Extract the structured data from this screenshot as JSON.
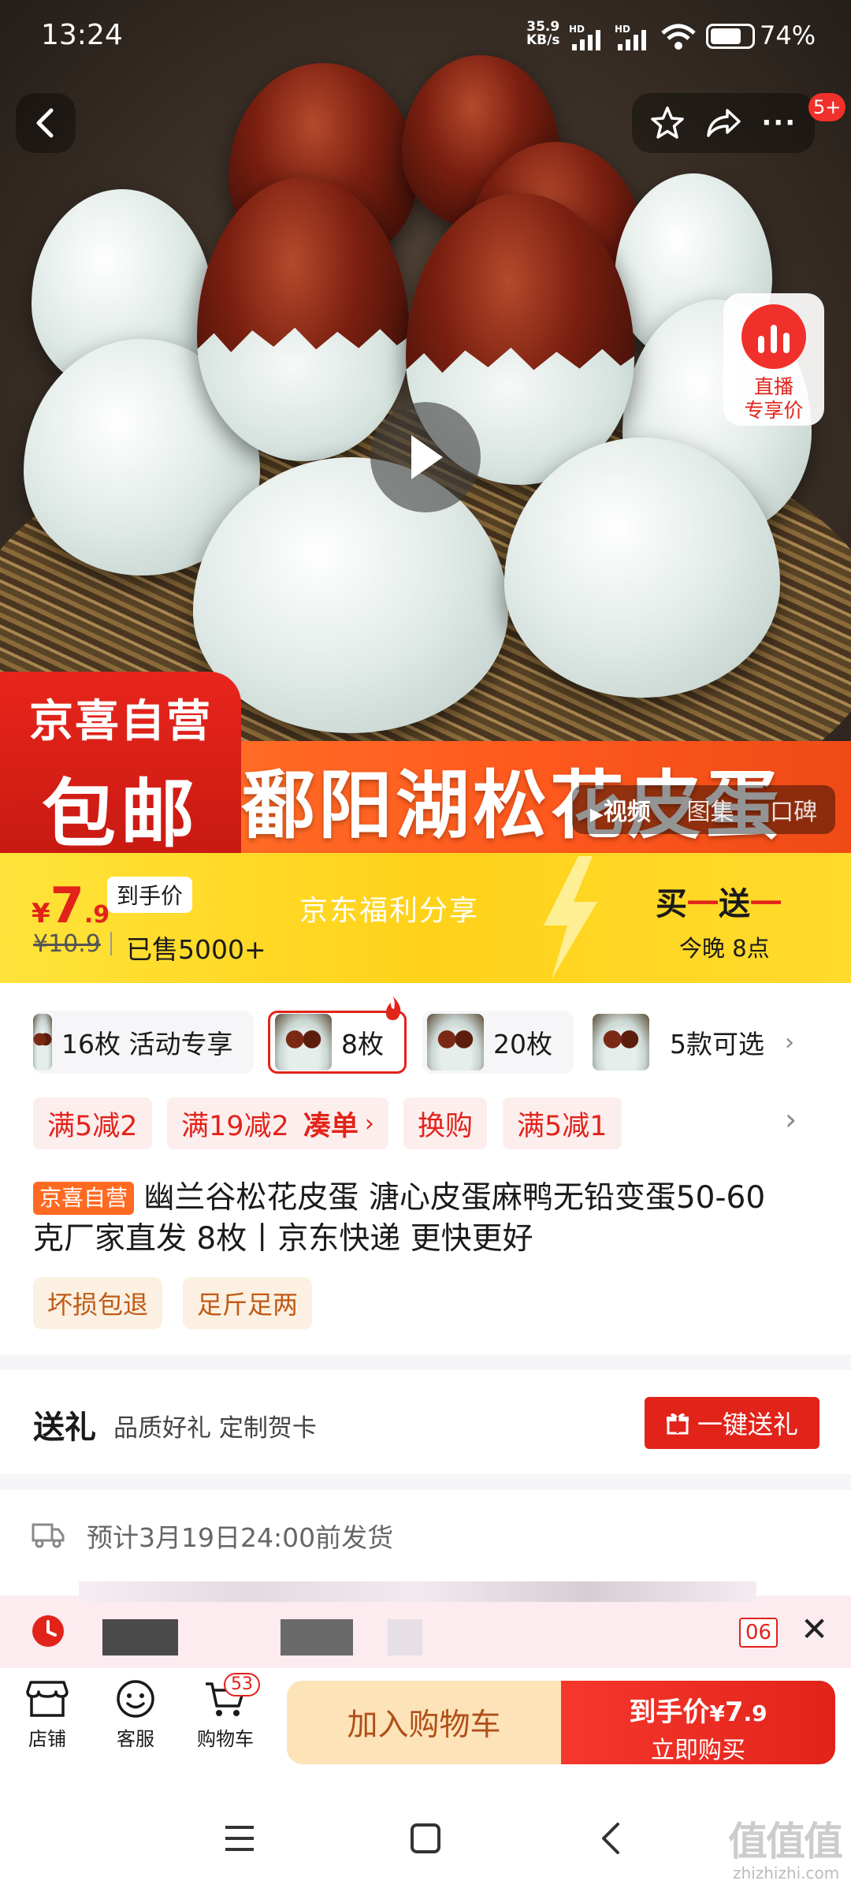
{
  "status_bar": {
    "time": "13:24",
    "net_speed_top": "35.9",
    "net_speed_bottom": "KB/s",
    "hd1": "HD",
    "hd2": "HD",
    "battery": "74%"
  },
  "top_bar": {
    "notification_badge": "5+"
  },
  "hero": {
    "live_label_1": "直播",
    "live_label_2": "专享价",
    "badge_line1": "京喜自营",
    "badge_line2": "包邮",
    "banner_text": "鄱阳湖松花皮蛋",
    "media_tabs": [
      "视频",
      "图集",
      "口碑"
    ]
  },
  "price_bar": {
    "currency": "¥",
    "price_int": "7",
    "price_dec": ".9",
    "price_tag": "到手价",
    "original_price": "¥10.9",
    "sold": "已售5000+",
    "share_text": "京东福利分享",
    "promo_title_a": "买",
    "promo_title_b": "一",
    "promo_title_c": "送",
    "promo_title_d": "一",
    "promo_time": "今晚 8点"
  },
  "variants": [
    {
      "label": "16枚 活动专享"
    },
    {
      "label": "8枚"
    },
    {
      "label": "20枚"
    },
    {
      "label": "5款可选"
    }
  ],
  "promos": [
    {
      "label": "满5减2"
    },
    {
      "label": "满19减2"
    },
    {
      "label": "凑单"
    },
    {
      "label": "换购"
    },
    {
      "label": "满5减1"
    }
  ],
  "product": {
    "store_tag": "京喜自营",
    "title_line1": "幽兰谷松花皮蛋 溏心皮蛋麻鸭无铅变蛋50-60",
    "title_line2": "克厂家直发 8枚丨京东快递 更快更好",
    "tags": [
      "坏损包退",
      "足斤足两"
    ]
  },
  "gift": {
    "title": "送礼",
    "desc": "品质好礼 定制贺卡",
    "button": "一键送礼"
  },
  "delivery": {
    "text": "预计3月19日24:00前发货"
  },
  "notice": {
    "suffix": "06"
  },
  "bottom_bar": {
    "shop": "店铺",
    "service": "客服",
    "cart": "购物车",
    "cart_count": "53",
    "add_cart": "加入购物车",
    "buy_price_label": "到手价",
    "buy_currency": "¥",
    "buy_price_int": "7",
    "buy_price_dec": ".9",
    "buy_now": "立即购买"
  },
  "watermark": {
    "logo": "值值值",
    "url": "zhizhizhi.com"
  },
  "colors": {
    "brand_red": "#e2231a",
    "yellow": "#ffd21a",
    "orange": "#ff6a22"
  }
}
